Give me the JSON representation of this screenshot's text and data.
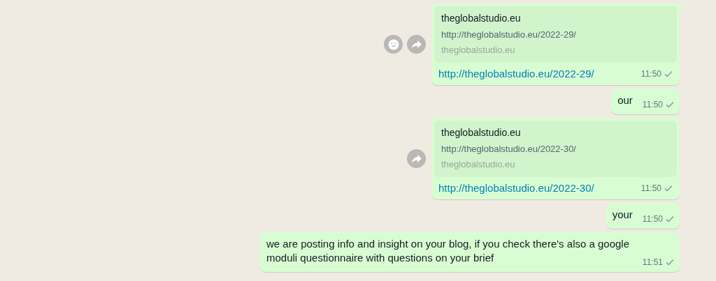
{
  "messages": [
    {
      "kind": "link",
      "preview": {
        "title": "theglobalstudio.eu",
        "url": "http://theglobalstudio.eu/2022-29/",
        "domain": "theglobalstudio.eu"
      },
      "text": "http://theglobalstudio.eu/2022-29/",
      "time": "11:50",
      "tail": true,
      "react_button": true,
      "forward_button": true
    },
    {
      "kind": "text",
      "text": "our",
      "time": "11:50",
      "tail": false,
      "react_button": false,
      "forward_button": false
    },
    {
      "kind": "link",
      "preview": {
        "title": "theglobalstudio.eu",
        "url": "http://theglobalstudio.eu/2022-30/",
        "domain": "theglobalstudio.eu"
      },
      "text": "http://theglobalstudio.eu/2022-30/",
      "time": "11:50",
      "tail": false,
      "react_button": false,
      "forward_button": true
    },
    {
      "kind": "text",
      "text": "your",
      "time": "11:50",
      "tail": false,
      "react_button": false,
      "forward_button": false
    },
    {
      "kind": "text",
      "text": "we are posting info and insight on your blog, if you check there's also a google moduli questionnaire with questions on your brief",
      "time": "11:51",
      "tail": false,
      "react_button": false,
      "forward_button": false
    }
  ]
}
